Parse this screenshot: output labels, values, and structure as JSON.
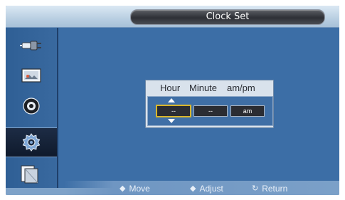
{
  "title": "Clock Set",
  "sidebar": {
    "items": [
      {
        "icon": "input-plug-icon",
        "selected": false
      },
      {
        "icon": "picture-icon",
        "selected": false
      },
      {
        "icon": "sound-icon",
        "selected": false
      },
      {
        "icon": "setup-gear-icon",
        "selected": true
      },
      {
        "icon": "multi-window-icon",
        "selected": false
      }
    ]
  },
  "dialog": {
    "headers": [
      "Hour",
      "Minute",
      "am/pm"
    ],
    "hour_value": "--",
    "minute_value": "--",
    "ampm_value": "am"
  },
  "footer": {
    "move_label": "Move",
    "adjust_label": "Adjust",
    "return_label": "Return"
  },
  "colors": {
    "background": "#3c6ea6",
    "selected_border": "#d9b62b",
    "footer": "#7ea2c8"
  }
}
